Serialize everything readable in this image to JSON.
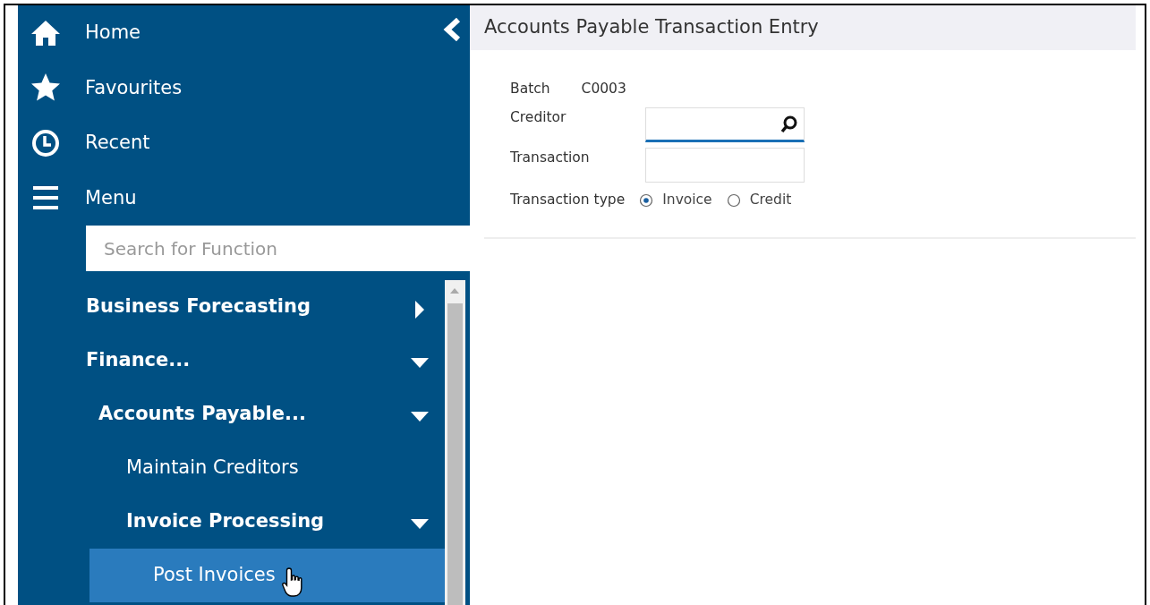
{
  "sidebar": {
    "nav": [
      {
        "kind": "home",
        "label": "Home"
      },
      {
        "kind": "star",
        "label": "Favourites"
      },
      {
        "kind": "clock",
        "label": "Recent"
      },
      {
        "kind": "menu",
        "label": "Menu"
      }
    ],
    "search": {
      "placeholder": "Search for Function"
    },
    "menu_tree": [
      {
        "kind": "folder",
        "label": "Business Forecasting",
        "expanded": false,
        "selected": false
      },
      {
        "kind": "folder",
        "label": "Finance...",
        "expanded": true,
        "selected": false,
        "children": [
          {
            "kind": "folder",
            "label": "Accounts Payable...",
            "expanded": true,
            "selected": false,
            "children": [
              {
                "kind": "function",
                "label": "Maintain Creditors",
                "selected": false
              },
              {
                "kind": "folder",
                "label": "Invoice Processing",
                "expanded": true,
                "selected": false,
                "children": [
                  {
                    "kind": "function",
                    "label": "Post Invoices",
                    "selected": true
                  }
                ]
              }
            ]
          }
        ]
      }
    ]
  },
  "page": {
    "title": "Accounts Payable Transaction Entry",
    "fields": [
      {
        "kind": "static",
        "label": "Batch",
        "value": "C0003"
      },
      {
        "kind": "lookup",
        "label": "Creditor",
        "focused": true
      },
      {
        "kind": "text",
        "label": "Transaction",
        "focused": false
      },
      {
        "kind": "radio",
        "label": "Transaction type",
        "options": [
          {
            "label": "Invoice",
            "selected": true
          },
          {
            "label": "Credit",
            "selected": false
          }
        ]
      }
    ]
  }
}
